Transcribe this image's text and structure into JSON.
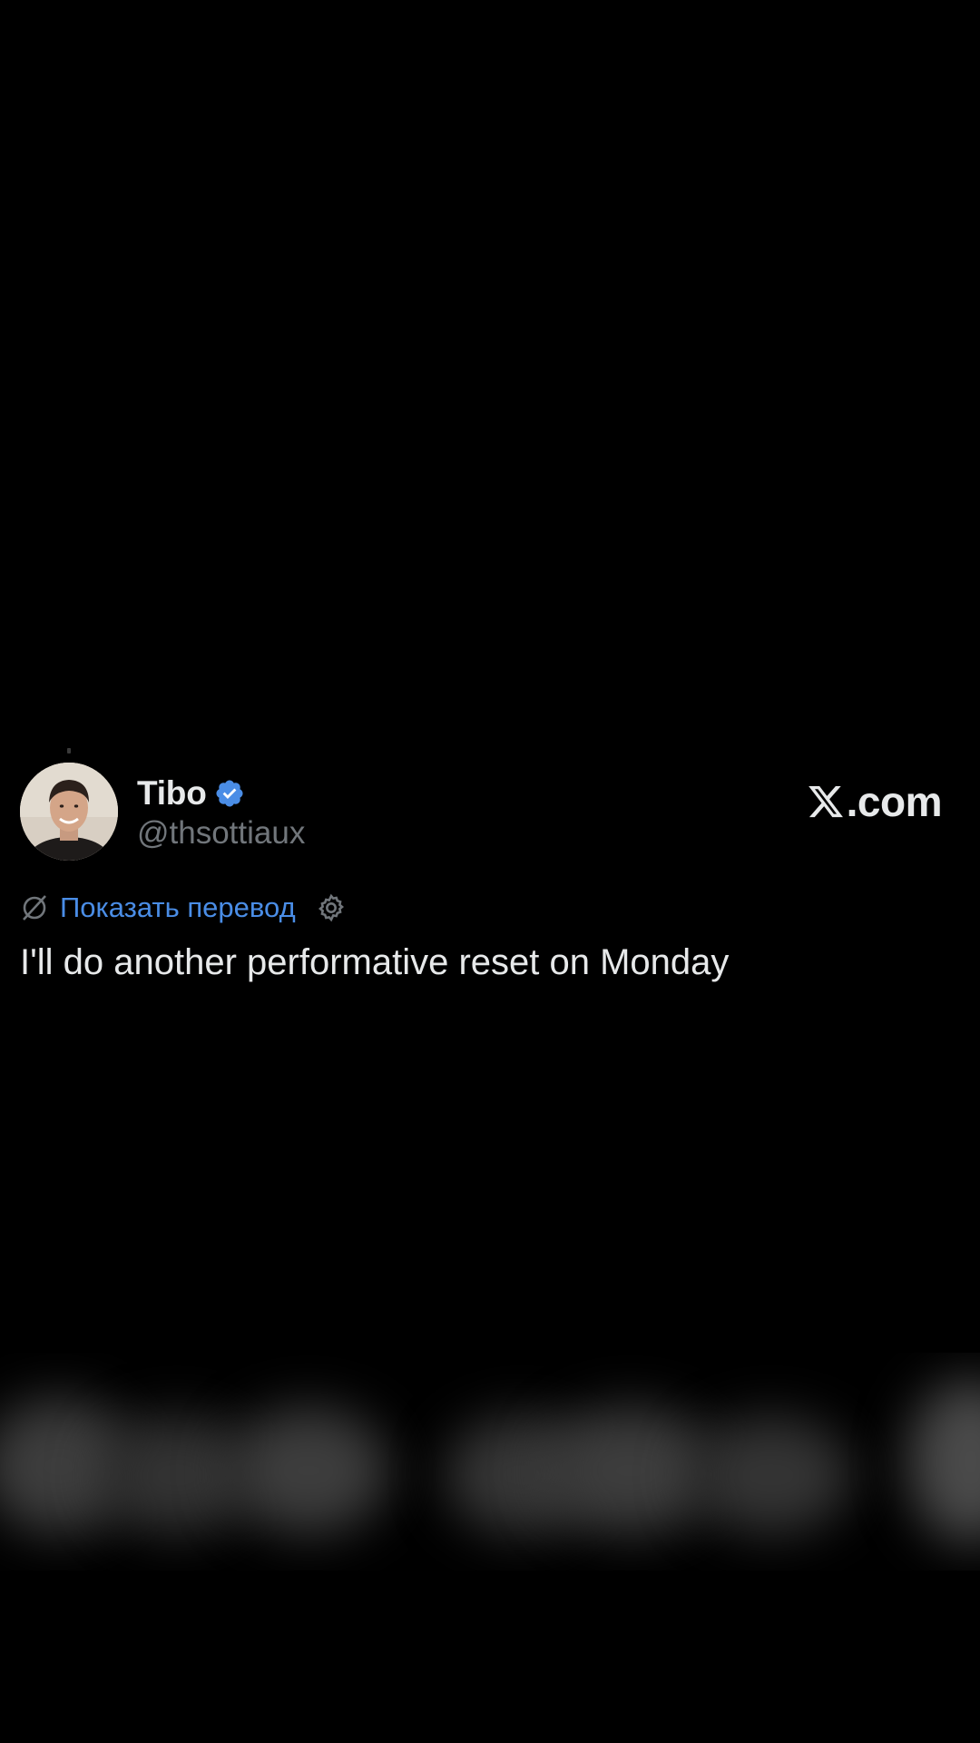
{
  "post": {
    "author_name": "Tibo",
    "author_handle": "@thsottiaux",
    "verified": true,
    "brand": "X.com",
    "brand_suffix": ".com",
    "translate_label": "Показать перевод",
    "text": "I'll do another performative reset on Monday"
  },
  "colors": {
    "background": "#000000",
    "text_primary": "#e7e9ea",
    "text_secondary": "#71767b",
    "link": "#4a8de6",
    "verified_badge": "#4a8de6"
  },
  "icons": {
    "verified": "verified-badge-icon",
    "translate": "translate-icon",
    "settings": "gear-icon",
    "brand": "x-logo-icon"
  }
}
